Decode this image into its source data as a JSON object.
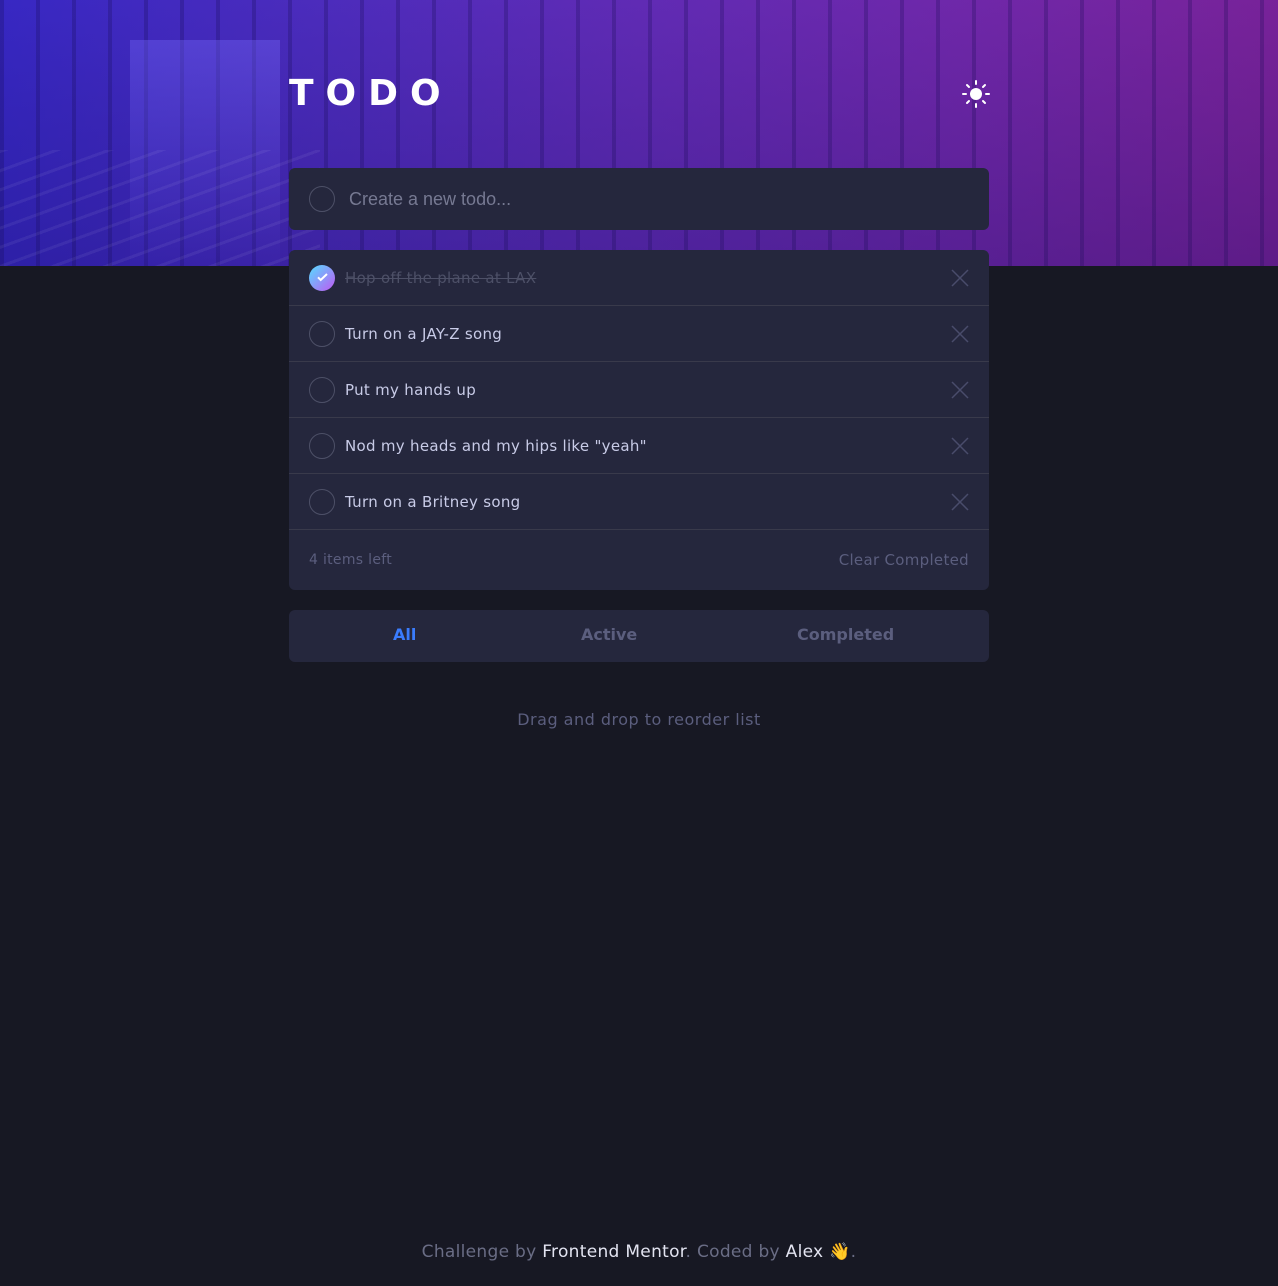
{
  "header": {
    "title": "TODO",
    "theme_toggle_icon": "sun-icon"
  },
  "new_todo": {
    "placeholder": "Create a new todo..."
  },
  "todos": [
    {
      "text": "Hop off the plane at LAX",
      "completed": true
    },
    {
      "text": "Turn on a JAY-Z song",
      "completed": false
    },
    {
      "text": "Put my hands up",
      "completed": false
    },
    {
      "text": "Nod my heads and my hips like \"yeah\"",
      "completed": false
    },
    {
      "text": "Turn on a Britney song",
      "completed": false
    }
  ],
  "list_footer": {
    "items_left": "4 items left",
    "clear_label": "Clear Completed"
  },
  "filters": {
    "all": "All",
    "active": "Active",
    "completed": "Completed",
    "selected": "All"
  },
  "hint": "Drag and drop to reorder list",
  "attribution": {
    "prefix": "Challenge by ",
    "link1": "Frontend Mentor",
    "middle": ". Coded by ",
    "link2": "Alex",
    "emoji": "👋",
    "suffix": "."
  },
  "colors": {
    "background": "#171823",
    "card": "#25273d",
    "accent": "#3a7cfd",
    "check_gradient_start": "#55ddff",
    "check_gradient_end": "#c058f3"
  }
}
